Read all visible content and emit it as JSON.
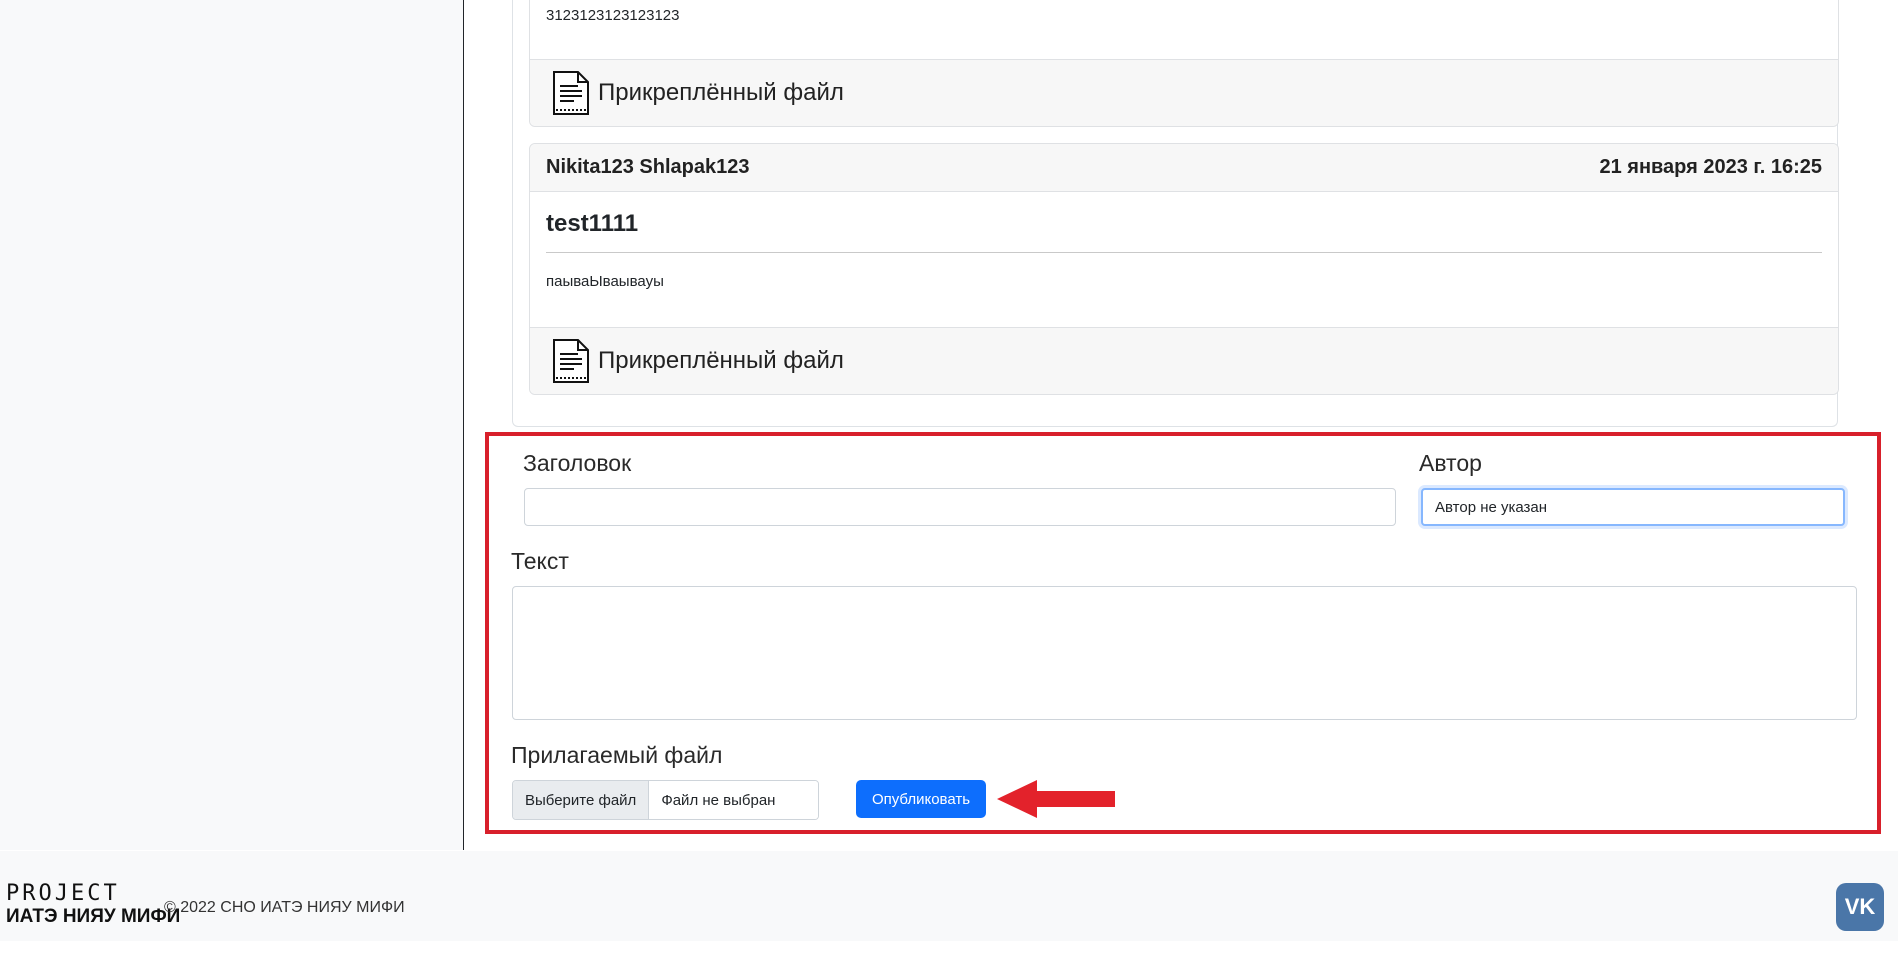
{
  "posts": [
    {
      "text": "3123123123123123",
      "attachment_label": "Прикреплённый файл"
    },
    {
      "author": "Nikita123 Shlapak123",
      "date": "21 января 2023 г. 16:25",
      "title": "test1111",
      "text": "паываЫваывауы",
      "attachment_label": "Прикреплённый файл"
    }
  ],
  "form": {
    "title_label": "Заголовок",
    "title_value": "",
    "author_label": "Автор",
    "author_value": "Автор не указан",
    "text_label": "Текст",
    "text_value": "",
    "file_label": "Прилагаемый файл",
    "file_button": "Выберите файл",
    "file_status": "Файл не выбран",
    "publish_button": "Опубликовать"
  },
  "footer": {
    "logo_top": "PROJECT",
    "logo_bottom": "ИАТЭ НИЯУ МИФИ",
    "copyright": "© 2022 СНО ИАТЭ НИЯУ МИФИ",
    "vk_icon": "vk-icon"
  },
  "colors": {
    "highlight_box": "#d8202b",
    "primary_button": "#0d6efd",
    "annotation_arrow": "#e3222b"
  }
}
